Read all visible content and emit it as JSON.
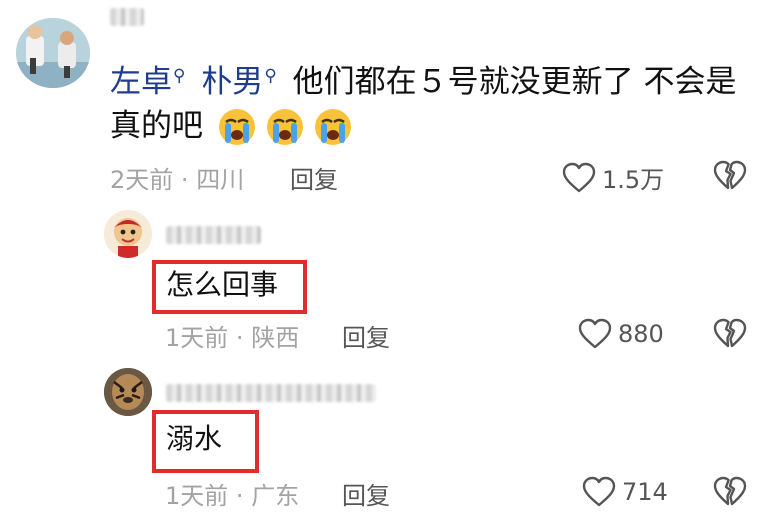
{
  "comment": {
    "mentions": [
      "左卓",
      "朴男"
    ],
    "text_line1": "他们都在５号就没更新了 不会是",
    "text_line2": "真的吧",
    "emoji": "crying-face",
    "emoji_count": 3,
    "time": "2天前",
    "location": "四川",
    "reply_label": "回复",
    "likes": "1.5万"
  },
  "replies": [
    {
      "text": "怎么回事",
      "time": "1天前",
      "location": "陕西",
      "reply_label": "回复",
      "likes": "880"
    },
    {
      "text": "溺水",
      "time": "1天前",
      "location": "广东",
      "reply_label": "回复",
      "likes": "714"
    }
  ],
  "icons": {
    "like": "heart-outline-icon",
    "dislike": "broken-heart-icon",
    "search": "search-icon"
  },
  "colors": {
    "mention": "#1f3d8c",
    "highlight_box": "#e02c2c",
    "meta": "#a3a3a3"
  },
  "separator": "·"
}
